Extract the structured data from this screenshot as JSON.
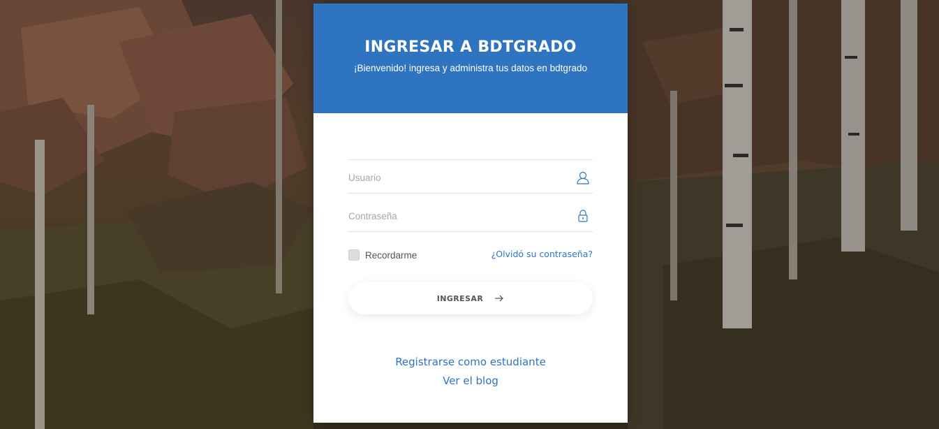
{
  "header": {
    "title": "INGRESAR A BDTGRADO",
    "subtitle": "¡Bienvenido! ingresa y administra tus datos en bdtgrado"
  },
  "form": {
    "username": {
      "placeholder": "Usuario",
      "value": "",
      "icon": "user-icon"
    },
    "password": {
      "placeholder": "Contraseña",
      "value": "",
      "icon": "lock-icon"
    },
    "remember_label": "Recordarme",
    "remember_checked": false,
    "forgot_link": "¿Olvidó su contraseña?",
    "submit_label": "INGRESAR",
    "submit_icon": "arrow-right-icon"
  },
  "links": {
    "register": "Registrarse como estudiante",
    "blog": "Ver el blog"
  },
  "colors": {
    "accent": "#2f74c0",
    "header_text": "#ffffff"
  }
}
